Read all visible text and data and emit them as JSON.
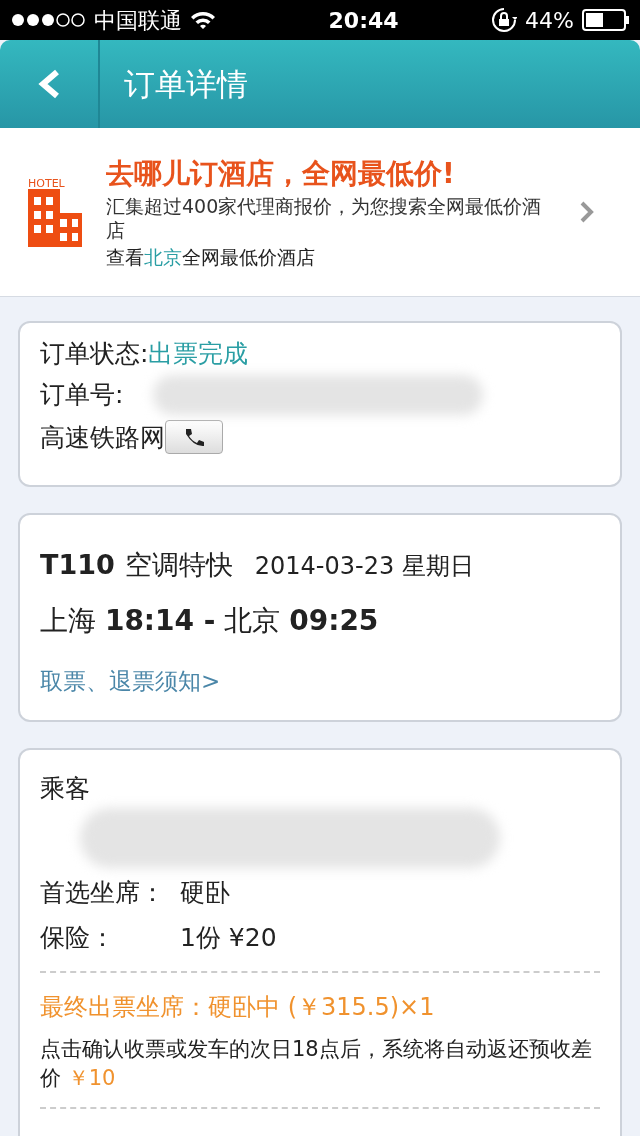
{
  "status_bar": {
    "carrier": "中国联通",
    "time": "20:44",
    "battery": "44%"
  },
  "header": {
    "title": "订单详情"
  },
  "hotel_ad": {
    "logo_label": "HOTEL",
    "title": "去哪儿订酒店，全网最低价!",
    "description": "汇集超过400家代理商报价，为您搜索全网最低价酒店",
    "link_prefix": "查看",
    "city": "北京",
    "link_suffix": "全网最低价酒店"
  },
  "order": {
    "status_label": "订单状态:",
    "status": "出票完成",
    "number_label": "订单号:",
    "number_redacted": true,
    "source": "高速铁路网"
  },
  "train": {
    "number": "T110",
    "type": "空调特快",
    "date": "2014-03-23 星期日",
    "route": "上海 **18:14 -** 北京 **09:25**",
    "notice_link": "取票、退票须知>"
  },
  "passenger": {
    "label": "乘客",
    "redacted": true,
    "rows": [
      {
        "label": "首选坐席：",
        "value": "硬卧"
      },
      {
        "label": "保险：",
        "value": "1份 ¥20"
      }
    ],
    "final_seat": "最终出票坐席：硬卧中 (￥315.5)×1",
    "note": {
      "text": "点击确认收票或发车的次日18点后，系统将自动返还预收差价",
      "amount": "￥10"
    }
  }
}
